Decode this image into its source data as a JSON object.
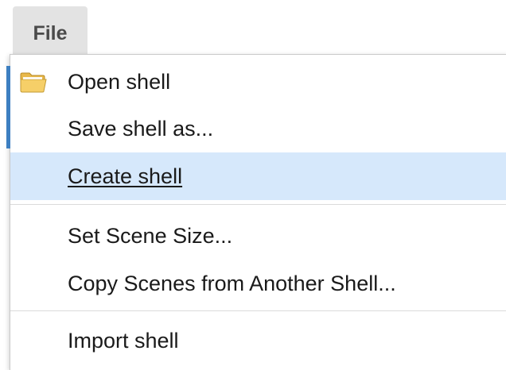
{
  "menu_bar": {
    "file_label": "File"
  },
  "file_menu": {
    "items": [
      {
        "label": "Open shell",
        "icon": "folder-icon"
      },
      {
        "label": "Save shell as..."
      },
      {
        "label": "Create shell",
        "state": "hovered"
      },
      {
        "label": "Set Scene Size..."
      },
      {
        "label": "Copy Scenes from Another Shell..."
      },
      {
        "label": "Import shell"
      }
    ]
  },
  "colors": {
    "highlight": "#d6e8fb",
    "accent": "#3d7fc1",
    "file_button_bg": "#e3e3e3"
  }
}
